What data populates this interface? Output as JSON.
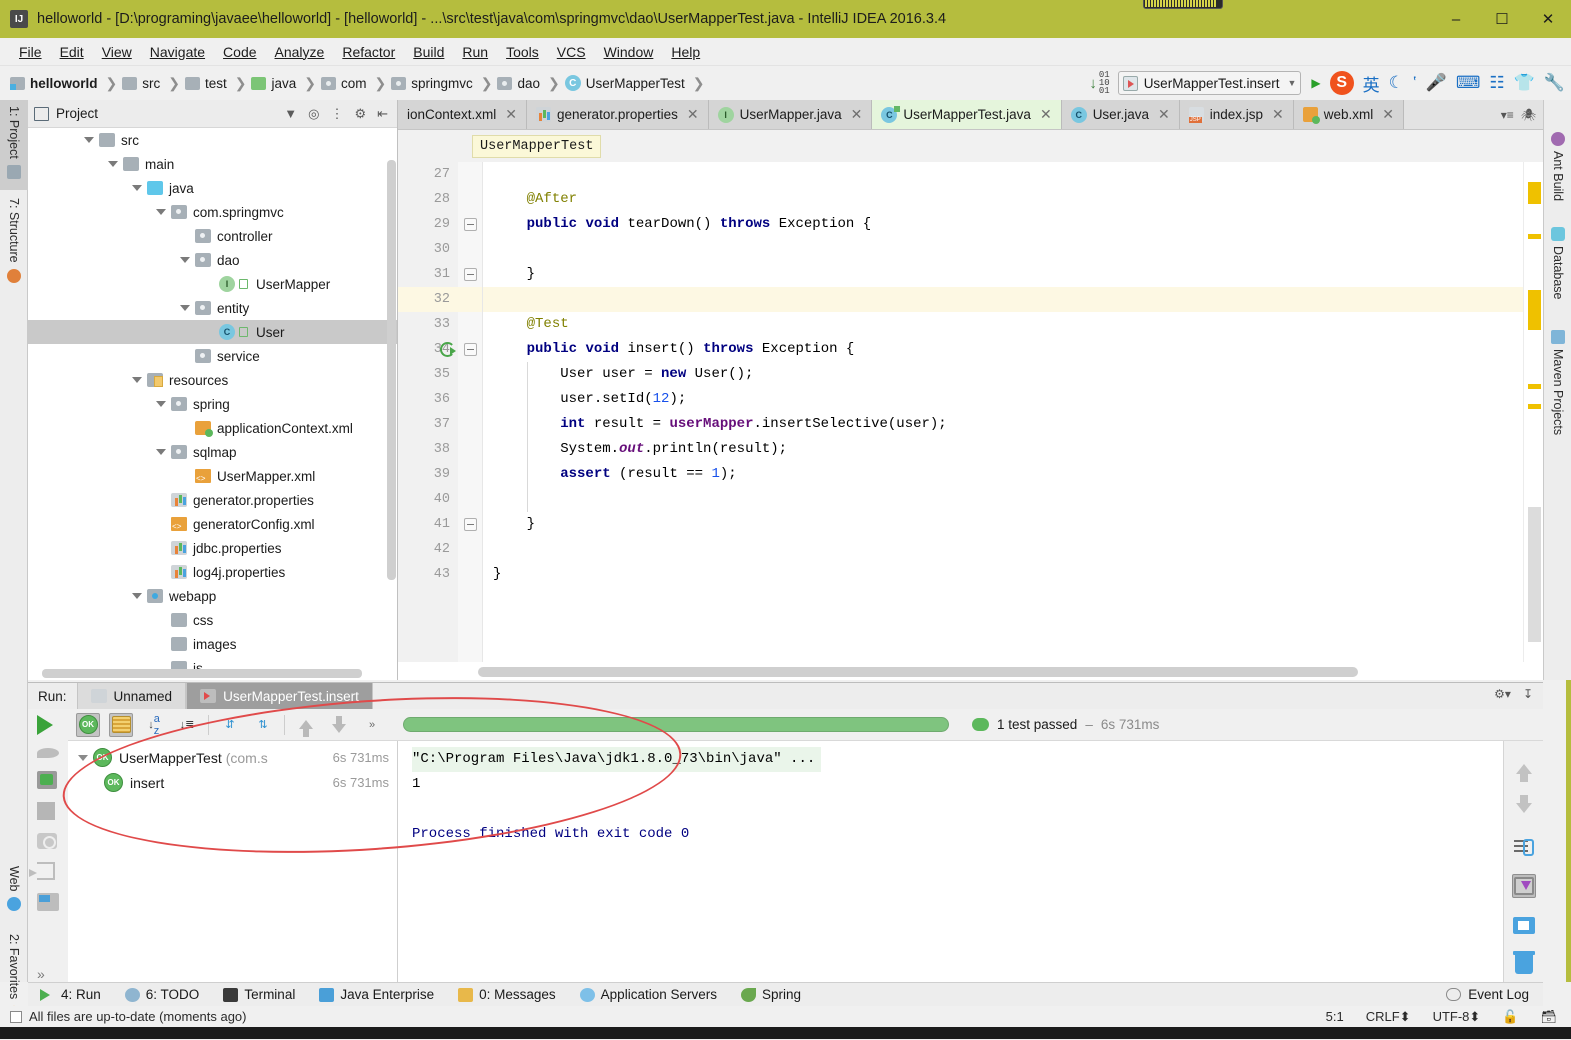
{
  "window": {
    "title": "helloworld - [D:\\programing\\javaee\\helloworld] - [helloworld] - ...\\src\\test\\java\\com\\springmvc\\dao\\UserMapperTest.java - IntelliJ IDEA 2016.3.4",
    "app_logo": "IJ",
    "minimize": "–",
    "maximize": "☐",
    "close": "✕"
  },
  "menu": [
    "File",
    "Edit",
    "View",
    "Navigate",
    "Code",
    "Analyze",
    "Refactor",
    "Build",
    "Run",
    "Tools",
    "VCS",
    "Window",
    "Help"
  ],
  "breadcrumb": [
    {
      "label": "helloworld",
      "icon": "module-icon"
    },
    {
      "label": "src",
      "icon": "folder-icon"
    },
    {
      "label": "test",
      "icon": "folder-icon"
    },
    {
      "label": "java",
      "icon": "source-root-icon"
    },
    {
      "label": "com",
      "icon": "package-icon"
    },
    {
      "label": "springmvc",
      "icon": "package-icon"
    },
    {
      "label": "dao",
      "icon": "package-icon"
    },
    {
      "label": "UserMapperTest",
      "icon": "test-class-icon"
    }
  ],
  "toolbar": {
    "run_config": "UserMapperTest.insert",
    "download_icon": "update-project-icon",
    "ime": {
      "logo": "S",
      "lang": "英",
      "items": [
        "moon-icon",
        "comma-icon",
        "mic-icon",
        "keyboard-icon",
        "emoji-icon",
        "skin-icon",
        "tools-icon"
      ]
    }
  },
  "left_strip": [
    {
      "label": "1: Project",
      "icon": "project-icon",
      "active": true
    },
    {
      "label": "7: Structure",
      "icon": "structure-icon",
      "active": false
    },
    {
      "label": "Web",
      "icon": "web-icon",
      "active": false
    },
    {
      "label": "2: Favorites",
      "icon": "favorites-star-icon",
      "active": false
    }
  ],
  "right_strip": [
    {
      "label": "Ant Build",
      "icon": "ant-icon"
    },
    {
      "label": "Database",
      "icon": "database-icon"
    },
    {
      "label": "Maven Projects",
      "icon": "maven-icon"
    }
  ],
  "project_panel": {
    "title": "Project",
    "header_icons": [
      "chevron-down-icon",
      "locate-icon",
      "collapse-all-icon",
      "gear-icon",
      "hide-icon"
    ],
    "tree": [
      {
        "label": "src",
        "depth": 2,
        "arrow": "open",
        "icon": "folder",
        "selected": false
      },
      {
        "label": "main",
        "depth": 3,
        "arrow": "open",
        "icon": "folder",
        "selected": false
      },
      {
        "label": "java",
        "depth": 4,
        "arrow": "open",
        "icon": "folder-blue",
        "selected": false
      },
      {
        "label": "com.springmvc",
        "depth": 5,
        "arrow": "open",
        "icon": "pkg",
        "selected": false
      },
      {
        "label": "controller",
        "depth": 6,
        "arrow": "none",
        "icon": "pkg",
        "selected": false
      },
      {
        "label": "dao",
        "depth": 6,
        "arrow": "open",
        "icon": "pkg",
        "selected": false
      },
      {
        "label": "UserMapper",
        "depth": 7,
        "arrow": "none",
        "icon": "iface",
        "selected": false,
        "lock": true
      },
      {
        "label": "entity",
        "depth": 6,
        "arrow": "open",
        "icon": "pkg",
        "selected": false
      },
      {
        "label": "User",
        "depth": 7,
        "arrow": "none",
        "icon": "cls",
        "selected": true,
        "lock": true
      },
      {
        "label": "service",
        "depth": 6,
        "arrow": "none",
        "icon": "pkg",
        "selected": false
      },
      {
        "label": "resources",
        "depth": 4,
        "arrow": "open",
        "icon": "res",
        "selected": false
      },
      {
        "label": "spring",
        "depth": 5,
        "arrow": "open",
        "icon": "pkg",
        "selected": false
      },
      {
        "label": "applicationContext.xml",
        "depth": 6,
        "arrow": "none",
        "icon": "xmlg",
        "selected": false
      },
      {
        "label": "sqlmap",
        "depth": 5,
        "arrow": "open",
        "icon": "pkg",
        "selected": false
      },
      {
        "label": "UserMapper.xml",
        "depth": 6,
        "arrow": "none",
        "icon": "xml",
        "selected": false
      },
      {
        "label": "generator.properties",
        "depth": 5,
        "arrow": "none",
        "icon": "props",
        "selected": false
      },
      {
        "label": "generatorConfig.xml",
        "depth": 5,
        "arrow": "none",
        "icon": "xml",
        "selected": false
      },
      {
        "label": "jdbc.properties",
        "depth": 5,
        "arrow": "none",
        "icon": "props",
        "selected": false
      },
      {
        "label": "log4j.properties",
        "depth": 5,
        "arrow": "none",
        "icon": "props",
        "selected": false
      },
      {
        "label": "webapp",
        "depth": 4,
        "arrow": "open",
        "icon": "web",
        "selected": false
      },
      {
        "label": "css",
        "depth": 5,
        "arrow": "none",
        "icon": "folder",
        "selected": false
      },
      {
        "label": "images",
        "depth": 5,
        "arrow": "none",
        "icon": "folder",
        "selected": false
      },
      {
        "label": "js",
        "depth": 5,
        "arrow": "none",
        "icon": "folder",
        "selected": false
      }
    ]
  },
  "editor": {
    "tabs": [
      {
        "label": "ionContext.xml",
        "icon": "xml-file-icon",
        "active": false,
        "truncated": true
      },
      {
        "label": "generator.properties",
        "icon": "properties-file-icon",
        "active": false
      },
      {
        "label": "UserMapper.java",
        "icon": "interface-icon",
        "active": false
      },
      {
        "label": "UserMapperTest.java",
        "icon": "test-class-icon",
        "active": true
      },
      {
        "label": "User.java",
        "icon": "class-icon",
        "active": false
      },
      {
        "label": "index.jsp",
        "icon": "jsp-file-icon",
        "active": false
      },
      {
        "label": "web.xml",
        "icon": "xml-file-icon",
        "active": false
      }
    ],
    "close_label": "✕",
    "breadcrumb_chip": "UserMapperTest",
    "first_line_number": 27,
    "highlight_line": 32,
    "run_gutter_line": 34,
    "lines": [
      {
        "n": 27,
        "text": ""
      },
      {
        "n": 28,
        "text": "    @After",
        "kind": "annotation"
      },
      {
        "n": 29,
        "text": "    public void tearDown() throws Exception {",
        "fold": true
      },
      {
        "n": 30,
        "text": ""
      },
      {
        "n": 31,
        "text": "    }",
        "fold": true
      },
      {
        "n": 32,
        "text": ""
      },
      {
        "n": 33,
        "text": "    @Test",
        "kind": "annotation"
      },
      {
        "n": 34,
        "text": "    public void insert() throws Exception {",
        "fold": true
      },
      {
        "n": 35,
        "text": "        User user = new User();"
      },
      {
        "n": 36,
        "text": "        user.setId(12);"
      },
      {
        "n": 37,
        "text": "        int result = userMapper.insertSelective(user);"
      },
      {
        "n": 38,
        "text": "        System.out.println(result);"
      },
      {
        "n": 39,
        "text": "        assert (result == 1);"
      },
      {
        "n": 40,
        "text": ""
      },
      {
        "n": 41,
        "text": "    }",
        "fold": true
      },
      {
        "n": 42,
        "text": ""
      },
      {
        "n": 43,
        "text": "}"
      }
    ]
  },
  "run_panel": {
    "label": "Run:",
    "tabs": [
      {
        "label": "Unnamed",
        "active": false,
        "icon": "config-icon"
      },
      {
        "label": "UserMapperTest.insert",
        "active": true,
        "icon": "test-config-icon"
      }
    ],
    "left_toolbar": [
      "rerun-icon",
      "rerun-failed-icon",
      "toggle-auto-test-icon",
      "stop-icon",
      "dump-threads-icon",
      "exit-icon",
      "layout-icon",
      "expand-more-icon"
    ],
    "test_toolbar": [
      "show-passed-icon",
      "show-ignored-icon",
      "sort-alphabetically-icon",
      "sort-by-duration-icon",
      "expand-all-icon",
      "collapse-all-icon",
      "prev-test-icon",
      "next-test-icon",
      "more-icon"
    ],
    "status": {
      "message": "1 test passed",
      "separator": "–",
      "duration": "6s 731ms",
      "progress": 100
    },
    "tree": [
      {
        "label": "UserMapperTest",
        "package": "(com.s",
        "time": "6s 731ms",
        "depth": 0,
        "status": "passed"
      },
      {
        "label": "insert",
        "package": "",
        "time": "6s 731ms",
        "depth": 1,
        "status": "passed"
      }
    ],
    "console": [
      {
        "text": "\"C:\\Program Files\\Java\\jdk1.8.0_73\\bin\\java\" ...",
        "style": "command"
      },
      {
        "text": "1",
        "style": "plain"
      },
      {
        "text": "",
        "style": "plain"
      },
      {
        "text": "Process finished with exit code 0",
        "style": "system"
      }
    ],
    "console_toolbar": [
      "scroll-up-icon",
      "scroll-down-icon",
      "soft-wrap-icon",
      "scroll-to-end-icon",
      "print-icon",
      "clear-all-icon"
    ],
    "top_right_icons": [
      "settings-icon",
      "hide-icon"
    ]
  },
  "bottom_bar": {
    "items": [
      {
        "label": "4: Run",
        "icon": "run-icon",
        "underline": "4"
      },
      {
        "label": "6: TODO",
        "icon": "todo-icon",
        "underline": "6"
      },
      {
        "label": "Terminal",
        "icon": "terminal-icon"
      },
      {
        "label": "Java Enterprise",
        "icon": "java-enterprise-icon"
      },
      {
        "label": "0: Messages",
        "icon": "messages-icon",
        "underline": "0"
      },
      {
        "label": "Application Servers",
        "icon": "app-servers-icon"
      },
      {
        "label": "Spring",
        "icon": "spring-icon"
      }
    ],
    "event_log": "Event Log"
  },
  "status_bar": {
    "message": "All files are up-to-date (moments ago)",
    "caret": "5:1",
    "line_separator": "CRLF⬍",
    "encoding": "UTF-8⬍",
    "lock_icon": "unlock-icon",
    "memory_icon": "memory-icon"
  }
}
